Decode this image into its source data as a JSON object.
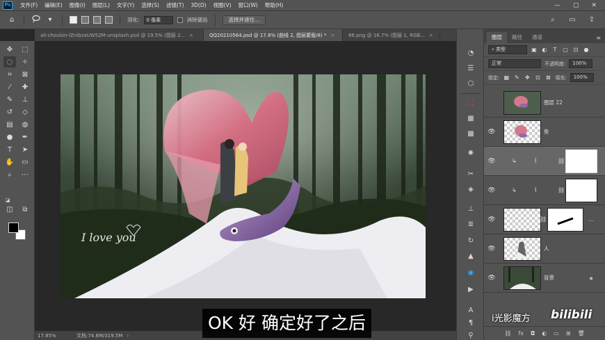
{
  "menu": [
    "文件(F)",
    "编辑(E)",
    "图像(I)",
    "图层(L)",
    "文字(Y)",
    "选择(S)",
    "滤镜(T)",
    "3D(D)",
    "视图(V)",
    "窗口(W)",
    "帮助(H)"
  ],
  "app_logo": "Ps",
  "window_controls": [
    "—",
    "▢",
    "✕"
  ],
  "options_bar": {
    "feather_label": "羽化:",
    "feather_value": "0 像素",
    "antialias_label": "消除锯齿",
    "select_mask_button": "选择并遮住..."
  },
  "tabs": [
    {
      "label": "ali-choubin-lZnibzaUW52M-unsplash.psd @ 19.5% (图层 2...",
      "active": false
    },
    {
      "label": "QQ20210564.psd @ 17.8% (曲线 2, 图层蒙版/8) *",
      "active": true
    },
    {
      "label": "86.png @ 16.7% (图层 1, RGB...",
      "active": false
    }
  ],
  "tab_close": "×",
  "status": {
    "zoom": "17.85%",
    "doc_size": "文档:74.6M/319.5M",
    "arrow": "›"
  },
  "subtitle": "OK 好 确定好了之后",
  "canvas_text": "I love you",
  "watermark": "i光影魔方",
  "bilibili": "bilibili",
  "panel": {
    "tabs": [
      "图层",
      "路径",
      "通道"
    ],
    "filter_label": "类型",
    "blend_mode": "正常",
    "opacity_label": "不透明度:",
    "opacity_value": "100%",
    "lock_label": "锁定:",
    "fill_label": "填充:",
    "fill_value": "100%"
  },
  "layers": [
    {
      "name": "图层 22",
      "visible": false
    },
    {
      "name": "鱼",
      "visible": true
    },
    {
      "name": "",
      "visible": true,
      "selected": true
    },
    {
      "name": "",
      "visible": true
    },
    {
      "name": "",
      "visible": true
    },
    {
      "name": "人",
      "visible": true
    },
    {
      "name": "背景",
      "visible": true
    }
  ],
  "panel_bottom_icons": [
    "link-icon",
    "fx-icon",
    "mask-icon",
    "adjustment-icon",
    "folder-icon",
    "new-layer-icon",
    "trash-icon"
  ],
  "colors": {
    "ui_bg": "#535353",
    "canvas_bg": "#282828",
    "accent": "#31a8ff",
    "foreground_color": "#000000",
    "background_color": "#ffffff"
  }
}
